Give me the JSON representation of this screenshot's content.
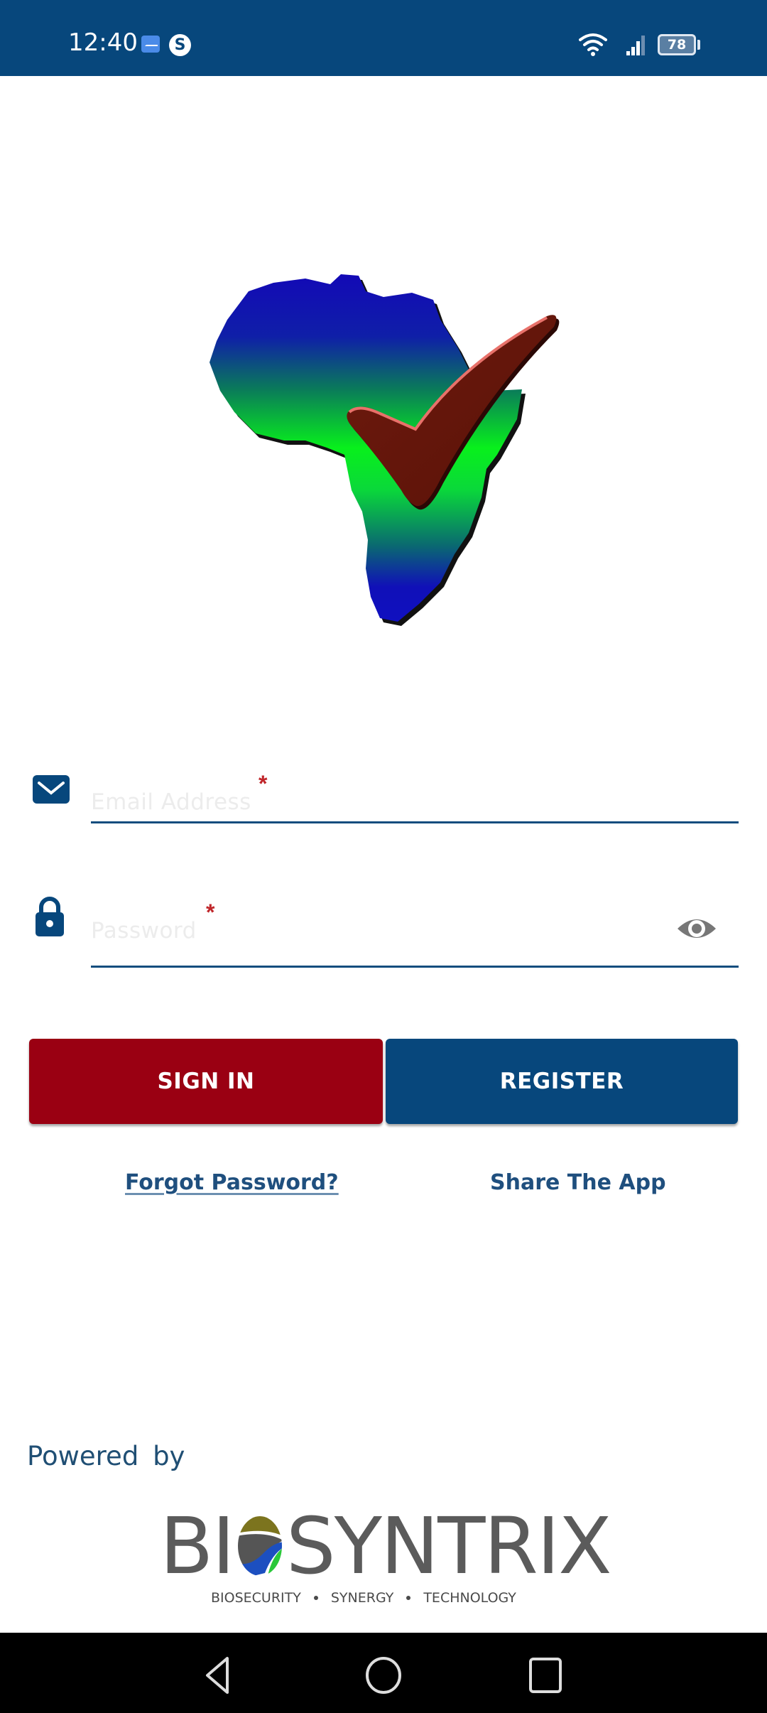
{
  "status_bar": {
    "time": "12:40",
    "notification_icons": [
      "mail-notification-icon",
      "skype-icon"
    ],
    "skype_letter": "S",
    "battery_percent": "78",
    "icons": [
      "wifi-icon",
      "signal-icon",
      "battery-icon"
    ]
  },
  "logo": {
    "description": "Africa map with check mark",
    "colors": {
      "top": "#1010b8",
      "middle": "#08ee24",
      "check": "#5e1408"
    }
  },
  "form": {
    "email": {
      "icon": "envelope-icon",
      "placeholder": "Email Address",
      "value": "",
      "required_mark": "*"
    },
    "password": {
      "icon": "lock-icon",
      "placeholder": "Password",
      "value": "",
      "required_mark": "*",
      "toggle_icon": "eye-icon"
    }
  },
  "buttons": {
    "sign_in": "SIGN IN",
    "register": "REGISTER"
  },
  "links": {
    "forgot_password": "Forgot Password?",
    "share_app": "Share The App"
  },
  "footer": {
    "powered_by": "Powered by",
    "brand_left": "BI",
    "brand_right": "SYNTRIX",
    "tagline": [
      "BIOSECURITY",
      "SYNERGY",
      "TECHNOLOGY"
    ]
  },
  "nav_bar": {
    "buttons": [
      "back-icon",
      "home-icon",
      "recents-icon"
    ]
  },
  "colors": {
    "primary_blue": "#07477c",
    "sign_in_red": "#9a0012",
    "required_red": "#c0262a",
    "link_blue": "#1f4f7e"
  }
}
